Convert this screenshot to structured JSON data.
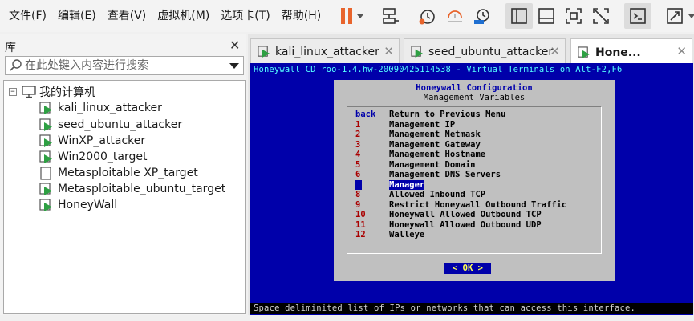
{
  "menubar": {
    "items": [
      "文件(F)",
      "编辑(E)",
      "查看(V)",
      "虚拟机(M)",
      "选项卡(T)",
      "帮助(H)"
    ]
  },
  "library": {
    "title": "库",
    "search_placeholder": "在此处键入内容进行搜索",
    "root_label": "我的计算机",
    "vms": [
      "kali_linux_attacker",
      "seed_ubuntu_attacker",
      "WinXP_attacker",
      "Win2000_target",
      "Metasploitable XP_target",
      "Metasploitable_ubuntu_target",
      "HoneyWall"
    ]
  },
  "tabs": [
    {
      "label": "kali_linux_attacker"
    },
    {
      "label": "seed_ubuntu_attacker"
    },
    {
      "label": "Hone..."
    }
  ],
  "console": {
    "header": "Honeywall CD roo-1.4.hw-20090425114538 - Virtual Terminals on Alt-F2,F6",
    "footer": "Space deliminited list of IPs or networks that can access this interface.",
    "dialog": {
      "title": "Honeywall Configuration",
      "subtitle": "Management Variables",
      "options": [
        {
          "key": "back",
          "text": "Return to Previous Menu"
        },
        {
          "key": "1",
          "text": "Management IP"
        },
        {
          "key": "2",
          "text": "Management Netmask"
        },
        {
          "key": "3",
          "text": "Management Gateway"
        },
        {
          "key": "4",
          "text": "Management Hostname"
        },
        {
          "key": "5",
          "text": "Management Domain"
        },
        {
          "key": "6",
          "text": "Management DNS Servers"
        },
        {
          "key": "7",
          "text": "Manager"
        },
        {
          "key": "8",
          "text": "Allowed Inbound TCP"
        },
        {
          "key": "9",
          "text": "Restrict Honeywall Outbound Traffic"
        },
        {
          "key": "10",
          "text": "Honeywall Allowed Outbound TCP"
        },
        {
          "key": "11",
          "text": "Honeywall Allowed Outbound UDP"
        },
        {
          "key": "12",
          "text": "Walleye"
        }
      ],
      "selected_index": 7,
      "ok_label": "< OK >"
    }
  },
  "colors": {
    "console_bg": "#0000aa",
    "header_text": "#55ffff",
    "dialog_bg": "#c0c0c0",
    "key_red": "#aa0000",
    "ok_text": "#ffff55",
    "accent_orange": "#e8642c",
    "vm_green": "#2ea043"
  },
  "icons": [
    "pause-icon",
    "network-icon",
    "snapshot-icon",
    "revert-snapshot-icon",
    "snapshot-manager-icon",
    "sidebar-view-icon",
    "thumbnail-bar-icon",
    "fullscreen-icon",
    "unity-icon",
    "console-icon",
    "stretch-icon",
    "computer-icon",
    "vm-icon"
  ]
}
